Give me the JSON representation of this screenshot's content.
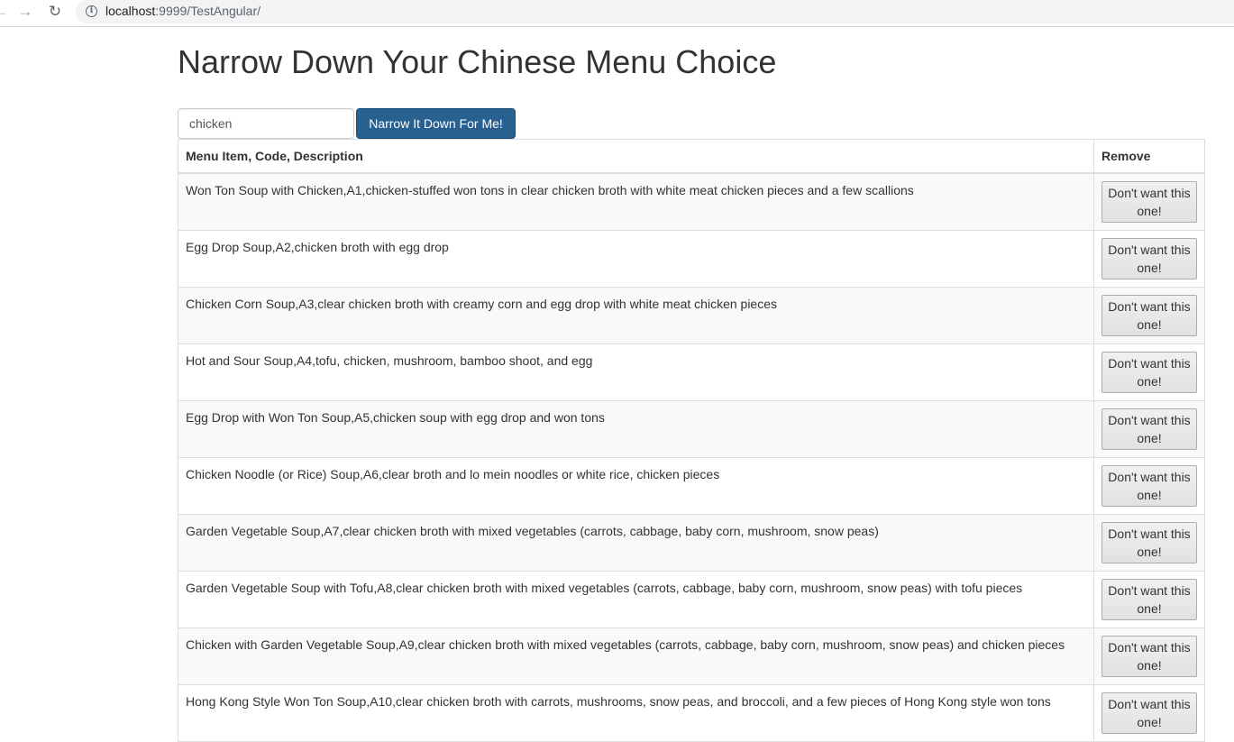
{
  "browser": {
    "back_icon": "←",
    "forward_icon": "→",
    "reload_icon": "↻",
    "info_icon": "i",
    "url_host": "localhost",
    "url_rest": ":9999/TestAngular/"
  },
  "page": {
    "title": "Narrow Down Your Chinese Menu Choice",
    "search": {
      "value": "chicken"
    },
    "narrow_button_label": "Narrow It Down For Me!"
  },
  "table": {
    "headers": [
      "Menu Item, Code, Description",
      "Remove"
    ],
    "remove_label": "Don't want this one!",
    "rows": [
      {
        "text": "Won Ton Soup with Chicken,A1,chicken-stuffed won tons in clear chicken broth with white meat chicken pieces and a few scallions"
      },
      {
        "text": "Egg Drop Soup,A2,chicken broth with egg drop"
      },
      {
        "text": "Chicken Corn Soup,A3,clear chicken broth with creamy corn and egg drop with white meat chicken pieces"
      },
      {
        "text": "Hot and Sour Soup,A4,tofu, chicken, mushroom, bamboo shoot, and egg"
      },
      {
        "text": "Egg Drop with Won Ton Soup,A5,chicken soup with egg drop and won tons"
      },
      {
        "text": "Chicken Noodle (or Rice) Soup,A6,clear broth and lo mein noodles or white rice, chicken pieces"
      },
      {
        "text": "Garden Vegetable Soup,A7,clear chicken broth with mixed vegetables (carrots, cabbage, baby corn, mushroom, snow peas)"
      },
      {
        "text": "Garden Vegetable Soup with Tofu,A8,clear chicken broth with mixed vegetables (carrots, cabbage, baby corn, mushroom, snow peas) with tofu pieces"
      },
      {
        "text": "Chicken with Garden Vegetable Soup,A9,clear chicken broth with mixed vegetables (carrots, cabbage, baby corn, mushroom, snow peas) and chicken pieces"
      },
      {
        "text": "Hong Kong Style Won Ton Soup,A10,clear chicken broth with carrots, mushrooms, snow peas, and broccoli, and a few pieces of Hong Kong style won tons"
      }
    ]
  }
}
